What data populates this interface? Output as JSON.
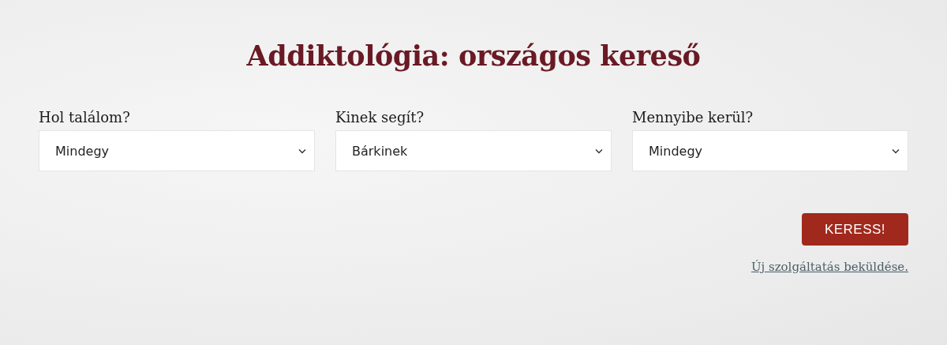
{
  "title": "Addiktológia: országos kereső",
  "filters": [
    {
      "label": "Hol találom?",
      "value": "Mindegy"
    },
    {
      "label": "Kinek segít?",
      "value": "Bárkinek"
    },
    {
      "label": "Mennyibe kerül?",
      "value": "Mindegy"
    }
  ],
  "search_button": "KERESS!",
  "submit_link": "Új szolgáltatás beküldése."
}
